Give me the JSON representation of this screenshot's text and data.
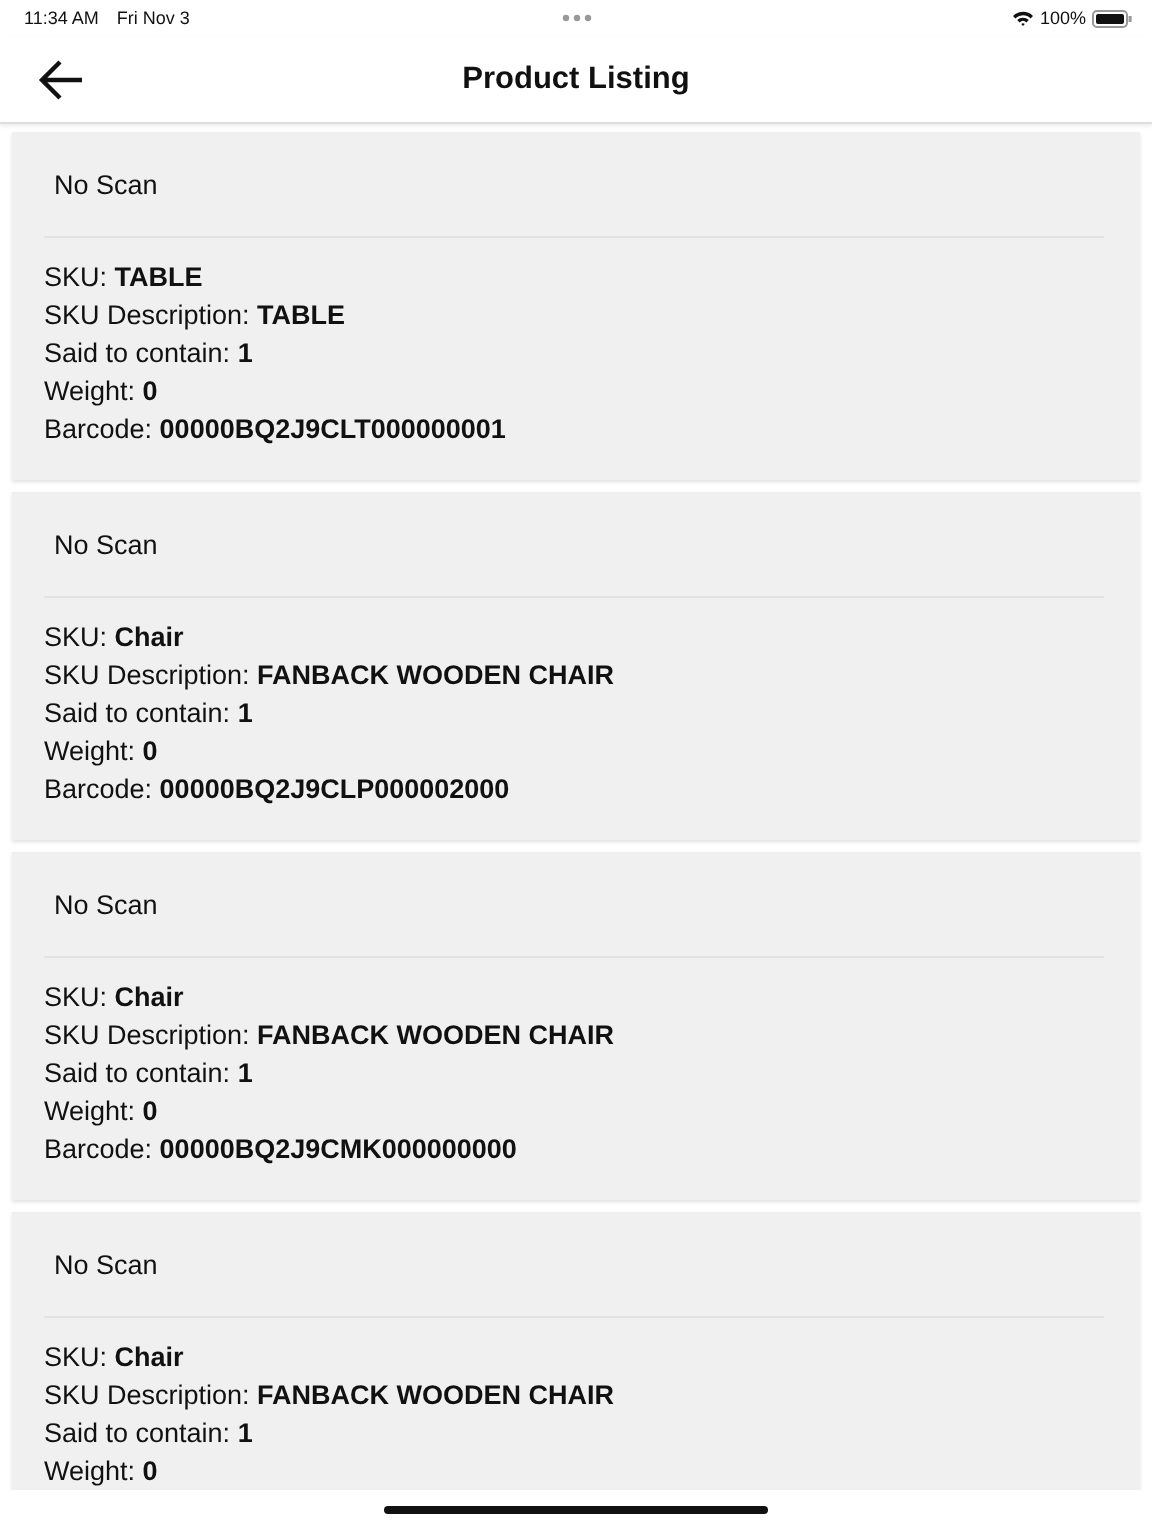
{
  "status_bar": {
    "time": "11:34 AM",
    "date": "Fri Nov 3",
    "battery": "100%"
  },
  "header": {
    "title": "Product Listing"
  },
  "products": [
    {
      "scan_status": "No Scan",
      "lines": [
        "SKU: **TABLE**",
        "SKU Description: **TABLE**",
        "Said to contain: **1**",
        "Weight: **0**",
        "Barcode: **00000BQ2J9CLT000000001**"
      ]
    },
    {
      "scan_status": "No Scan",
      "lines": [
        "SKU: **Chair**",
        "SKU Description: **FANBACK WOODEN CHAIR**",
        "Said to contain: **1**",
        "Weight: **0**",
        "Barcode: **00000BQ2J9CLP000002000**"
      ]
    },
    {
      "scan_status": "No Scan",
      "lines": [
        "SKU: **Chair**",
        "SKU Description: **FANBACK WOODEN CHAIR**",
        "Said to contain: **1**",
        "Weight: **0**",
        "Barcode: **00000BQ2J9CMK000000000**"
      ]
    },
    {
      "scan_status": "No Scan",
      "lines": [
        "SKU: **Chair**",
        "SKU Description: **FANBACK WOODEN CHAIR**",
        "Said to contain: **1**",
        "Weight: **0**"
      ]
    }
  ]
}
